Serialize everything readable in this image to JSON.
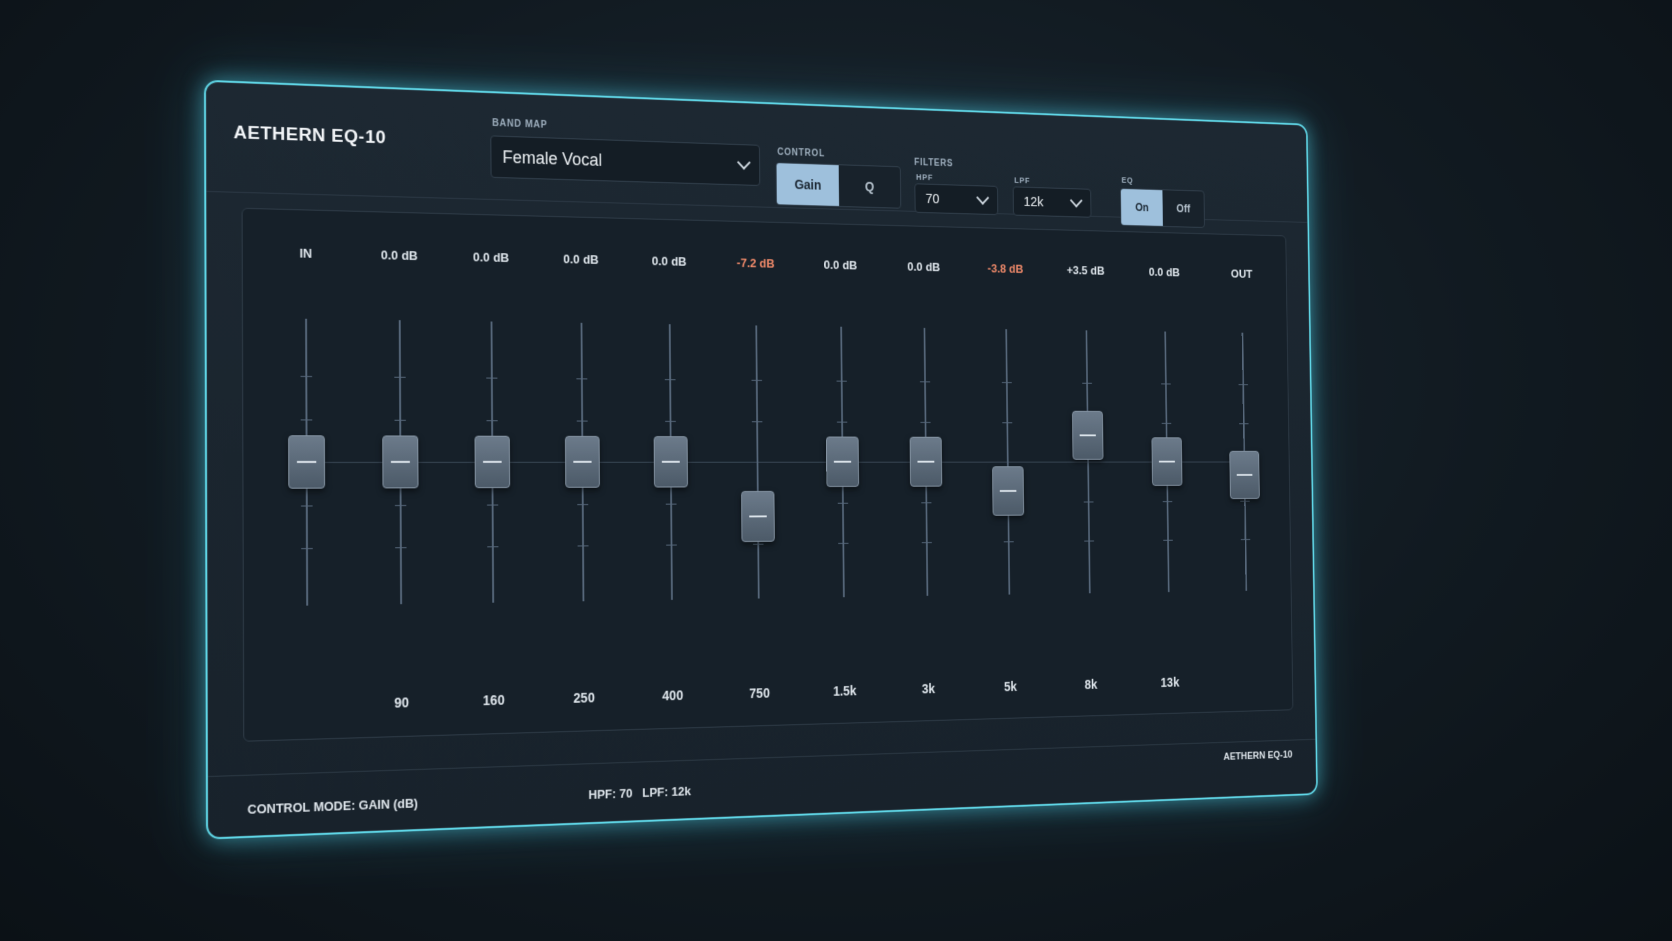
{
  "app": {
    "title": "AETHERN EQ-10"
  },
  "band_map": {
    "label": "BAND MAP",
    "value": "Female Vocal"
  },
  "control": {
    "label": "CONTROL",
    "options": [
      "Gain",
      "Q"
    ],
    "active": "Gain"
  },
  "filters": {
    "label": "FILTERS",
    "hpf": {
      "label": "HPF",
      "value": "70"
    },
    "lpf": {
      "label": "LPF",
      "value": "12k"
    }
  },
  "eq": {
    "label": "EQ",
    "options": [
      "On",
      "Off"
    ],
    "active": "On"
  },
  "channels": [
    {
      "top": "IN",
      "freq": "",
      "level": 0.5,
      "neg": false
    },
    {
      "top": "0.0 dB",
      "freq": "90",
      "level": 0.5,
      "neg": false
    },
    {
      "top": "0.0 dB",
      "freq": "160",
      "level": 0.5,
      "neg": false
    },
    {
      "top": "0.0 dB",
      "freq": "250",
      "level": 0.5,
      "neg": false
    },
    {
      "top": "0.0 dB",
      "freq": "400",
      "level": 0.5,
      "neg": false
    },
    {
      "top": "-7.2 dB",
      "freq": "750",
      "level": 0.3,
      "neg": true
    },
    {
      "top": "0.0 dB",
      "freq": "1.5k",
      "level": 0.5,
      "neg": false
    },
    {
      "top": "0.0 dB",
      "freq": "3k",
      "level": 0.5,
      "neg": false
    },
    {
      "top": "-3.8 dB",
      "freq": "5k",
      "level": 0.39,
      "neg": true
    },
    {
      "top": "+3.5 dB",
      "freq": "8k",
      "level": 0.6,
      "neg": false
    },
    {
      "top": "0.0 dB",
      "freq": "13k",
      "level": 0.5,
      "neg": false
    },
    {
      "top": "OUT",
      "freq": "",
      "level": 0.45,
      "neg": false
    }
  ],
  "status": {
    "mode": "CONTROL MODE: GAIN (dB)",
    "filters": "HPF: 70   LPF: 12k",
    "brand": "AETHERN EQ-10"
  }
}
